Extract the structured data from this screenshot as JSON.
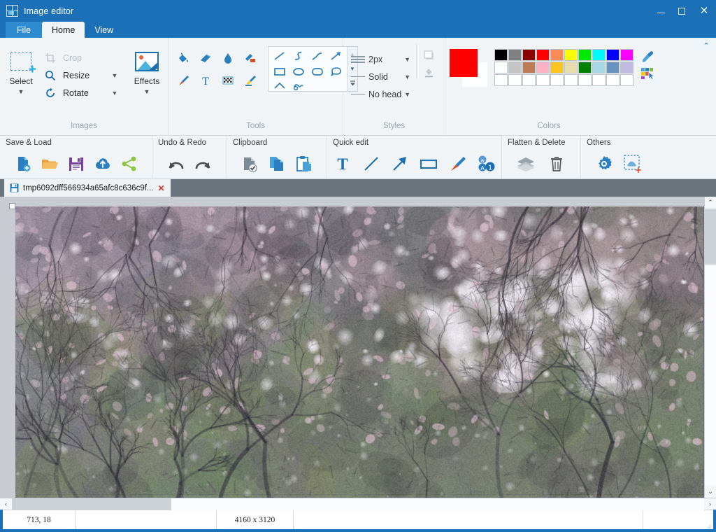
{
  "window": {
    "title": "Image editor",
    "icon": "app-image-icon",
    "controls": {
      "minimize": "–",
      "maximize": "□",
      "close": "✕"
    },
    "collapse_ribbon": "⌃"
  },
  "ribbon_tabs": [
    {
      "label": "File",
      "active": false,
      "kind": "file"
    },
    {
      "label": "Home",
      "active": true,
      "kind": "normal"
    },
    {
      "label": "View",
      "active": false,
      "kind": "normal"
    }
  ],
  "ribbon": {
    "images": {
      "group_label": "Images",
      "select": {
        "label": "Select",
        "caret": "▼"
      },
      "crop": {
        "label": "Crop",
        "disabled": true
      },
      "resize": {
        "label": "Resize",
        "caret": "▼"
      },
      "rotate": {
        "label": "Rotate",
        "caret": "▼"
      },
      "effects": {
        "label": "Effects",
        "caret": "▼"
      }
    },
    "tools": {
      "group_label": "Tools",
      "buttons": [
        "fill-bucket-icon",
        "eraser-icon",
        "water-drop-icon",
        "color-replace-icon",
        "paintbrush-icon",
        "text-tool-icon",
        "transparency-checker-icon",
        "highlighter-icon"
      ],
      "shapes": [
        "line-shape",
        "s-curve-shape",
        "curve-shape",
        "arrow-shape",
        "rectangle-shape",
        "ellipse-shape",
        "rounded-rect-shape",
        "speech-bubble-shape",
        "chevron-shape",
        "scribble-shape"
      ],
      "gallery_scroll": {
        "up": "▲",
        "down": "▼",
        "more": "▼"
      }
    },
    "styles": {
      "group_label": "Styles",
      "width": {
        "value": "2px",
        "caret": "▼"
      },
      "dash": {
        "value": "Solid",
        "caret": "▼"
      },
      "arrowhead": {
        "value": "No head",
        "caret": "▼"
      },
      "side_buttons": [
        "shadow-style-icon",
        "fill-style-icon"
      ]
    },
    "colors": {
      "group_label": "Colors",
      "primary": "#fe0000",
      "secondary": "#ffffff",
      "row1": [
        "#000000",
        "#808080",
        "#8b0000",
        "#fe0000",
        "#fb8a54",
        "#fdfc00",
        "#00e800",
        "#00fbfb",
        "#0000fe",
        "#ff00ff"
      ],
      "row2": [
        "#ffffff",
        "#c5c5c5",
        "#bb7b54",
        "#ffb3c4",
        "#fbc41e",
        "#e8dcae",
        "#008000",
        "#a6d8e8",
        "#6a92c0",
        "#c0bae0"
      ],
      "row3": [
        "#ffffff",
        "#ffffff",
        "#ffffff",
        "#ffffff",
        "#ffffff",
        "#ffffff",
        "#ffffff",
        "#ffffff",
        "#ffffff",
        "#ffffff"
      ],
      "picker": "eyedropper-icon",
      "palette": "color-palette-icon"
    }
  },
  "quickbar": [
    {
      "title": "Save & Load",
      "buttons": [
        "new-file-icon",
        "open-folder-icon",
        "save-disk-icon",
        "upload-cloud-icon",
        "share-icon"
      ]
    },
    {
      "title": "Undo & Redo",
      "buttons": [
        "undo-arrow-icon",
        "redo-arrow-icon"
      ]
    },
    {
      "title": "Clipboard",
      "buttons": [
        "cut-icon",
        "copy-icon",
        "paste-icon"
      ]
    },
    {
      "title": "Quick edit",
      "buttons": [
        "text-icon",
        "line-icon",
        "arrow-icon",
        "rectangle-icon",
        "brush-icon",
        "auto-number-icon"
      ]
    },
    {
      "title": "Flatten & Delete",
      "buttons": [
        "layers-flatten-icon",
        "trash-delete-icon"
      ]
    },
    {
      "title": "Others",
      "buttons": [
        "settings-gear-icon",
        "add-stamp-icon"
      ]
    }
  ],
  "document_tabs": [
    {
      "label": "tmp6092dff566934a65afc8c636c9f...",
      "icon": "save-disk-icon",
      "close": "✕",
      "active": true
    }
  ],
  "canvas": {
    "image_alt": "photograph of trees with pink blossoms and bright sky gaps",
    "scroll": {
      "up": "⌃",
      "down": "⌄",
      "left": "‹",
      "right": "›"
    }
  },
  "statusbar": {
    "cursor_position": "713, 18",
    "field2": "",
    "image_size": "4160 x 3120",
    "field4": "",
    "field5": ""
  }
}
